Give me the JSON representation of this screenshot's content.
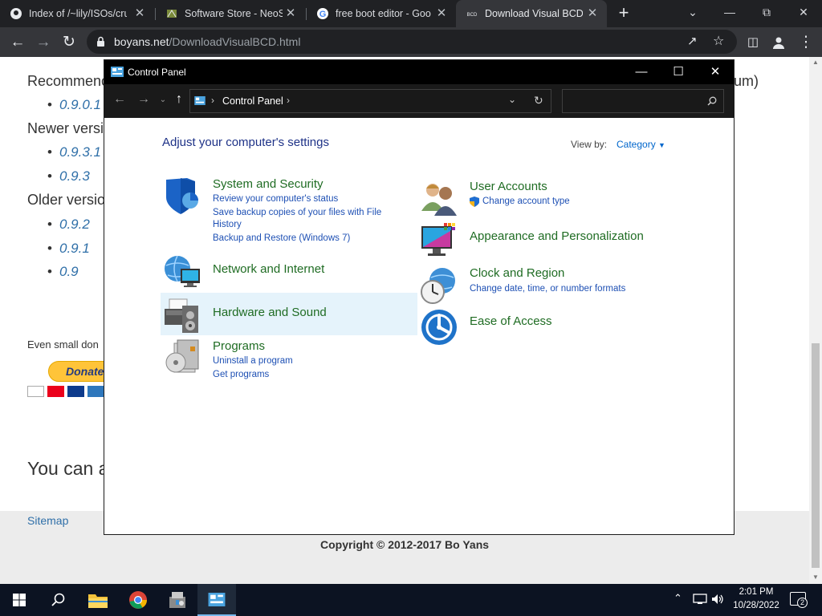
{
  "browser": {
    "tabs": [
      {
        "label": "Index of /~lily/ISOs/cru",
        "close": "✕"
      },
      {
        "label": "Software Store - NeoSr",
        "close": "✕"
      },
      {
        "label": "free boot editor - Goo",
        "close": "✕"
      },
      {
        "label": "Download Visual BCD",
        "close": "✕"
      }
    ],
    "new_tab": "+",
    "url_host": "boyans.net",
    "url_path": "/DownloadVisualBCD.html"
  },
  "webpage": {
    "recommended": "Recommenc",
    "recommended_suffix": "um)",
    "rec_versions": [
      "0.9.0.1"
    ],
    "newer": "Newer versi",
    "newer_versions": [
      "0.9.3.1",
      "0.9.3"
    ],
    "older": "Older versio",
    "older_versions": [
      "0.9.2",
      "0.9.1",
      "0.9"
    ],
    "donation_text": "Even small don",
    "donate_button": "Donate",
    "big_text": "You can a",
    "sitemap": "Sitemap",
    "copyright": "Copyright © 2012-2017 Bo Yans"
  },
  "control_panel": {
    "window_title": "Control Panel",
    "breadcrumb": "Control Panel",
    "heading": "Adjust your computer's settings",
    "view_by_label": "View by:",
    "view_by_value": "Category",
    "categories_left": [
      {
        "title": "System and Security",
        "links": [
          "Review your computer's status",
          "Save backup copies of your files with File",
          "History",
          "Backup and Restore (Windows 7)"
        ]
      },
      {
        "title": "Network and Internet",
        "links": []
      },
      {
        "title": "Hardware and Sound",
        "links": []
      },
      {
        "title": "Programs",
        "links": [
          "Uninstall a program",
          "Get programs"
        ]
      }
    ],
    "categories_right": [
      {
        "title": "User Accounts",
        "links": [
          "Change account type"
        ]
      },
      {
        "title": "Appearance and Personalization",
        "links": []
      },
      {
        "title": "Clock and Region",
        "links": [
          "Change date, time, or number formats"
        ]
      },
      {
        "title": "Ease of Access",
        "links": []
      }
    ]
  },
  "taskbar": {
    "time": "2:01 PM",
    "date": "10/28/2022",
    "notification_count": "2"
  },
  "colors": {
    "link_blue": "#1e50b4",
    "category_green": "#1f6c23",
    "heading_navy": "#1e3287"
  }
}
